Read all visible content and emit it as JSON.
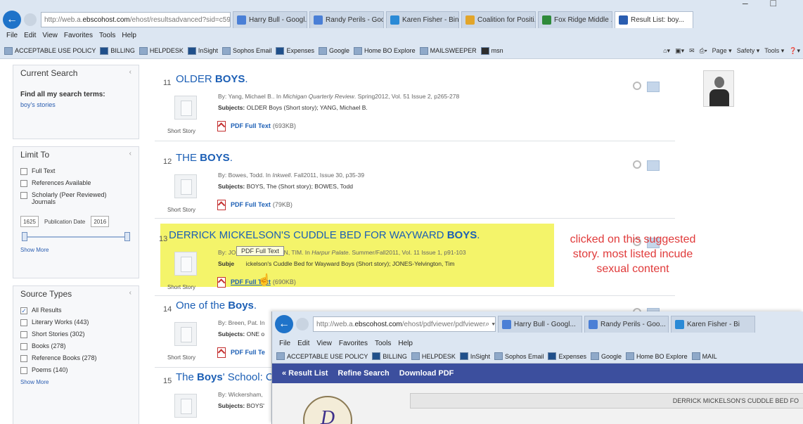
{
  "browser": {
    "address": {
      "prefix": "http://web.a.",
      "host": "ebscohost.com",
      "path": "/ehost/resultsadvanced?sid=c59d...",
      "controls": "⌕ ▾ ↻"
    },
    "tabs": [
      {
        "label": "Harry Bull - Googl...",
        "icon_color": "#4a7fd6"
      },
      {
        "label": "Randy Perils - Goo...",
        "icon_color": "#4a7fd6"
      },
      {
        "label": "Karen Fisher - Bing",
        "icon_color": "#2a8ad6"
      },
      {
        "label": "Coalition for Positi...",
        "icon_color": "#e2a52a"
      },
      {
        "label": "Fox Ridge Middle ...",
        "icon_color": "#2f8a3a"
      },
      {
        "label": "Result List: boy...",
        "icon_color": "#2a5db0"
      }
    ],
    "window_controls": "– □",
    "menu": [
      "File",
      "Edit",
      "View",
      "Favorites",
      "Tools",
      "Help"
    ],
    "favorites": [
      "ACCEPTABLE USE POLICY",
      "BILLING",
      "HELPDESK",
      "InSight",
      "Sophos Email",
      "Expenses",
      "Google",
      "Home BO Explore",
      "MAILSWEEPER",
      "msn"
    ],
    "commands": [
      "Page ▾",
      "Safety ▾",
      "Tools ▾"
    ]
  },
  "sidebar": {
    "current_search": {
      "heading": "Current Search",
      "find_all_label": "Find all my search terms:",
      "term": "boy's stories"
    },
    "limit_to": {
      "heading": "Limit To",
      "options": [
        {
          "label": "Full Text",
          "checked": false
        },
        {
          "label": "References Available",
          "checked": false
        },
        {
          "label": "Scholarly (Peer Reviewed) Journals",
          "checked": false
        }
      ],
      "date_from": "1625",
      "date_label": "Publication Date",
      "date_to": "2016",
      "show_more": "Show More"
    },
    "source_types": {
      "heading": "Source Types",
      "options": [
        {
          "label": "All Results",
          "checked": true
        },
        {
          "label": "Literary Works (443)",
          "checked": false
        },
        {
          "label": "Short Stories (302)",
          "checked": false
        },
        {
          "label": "Books (278)",
          "checked": false
        },
        {
          "label": "Reference Books (278)",
          "checked": false
        },
        {
          "label": "Poems (140)",
          "checked": false
        }
      ],
      "show_more": "Show More"
    }
  },
  "results": [
    {
      "num": "11",
      "title_plain": "OLDER ",
      "title_bold": "BOYS",
      "title_tail": ".",
      "meta_by": "By: Yang, Michael B.. ",
      "meta_in": "In ",
      "meta_source": "Michigan Quarterly Review",
      "meta_rest": ". Spring2012, Vol. 51 Issue 2, p265-278",
      "subjects_label": "Subjects:",
      "subjects": " OLDER Boys (Short story); YANG, Michael B.",
      "type": "Short Story",
      "pdf_label": "PDF Full Text",
      "pdf_size": "(693KB)"
    },
    {
      "num": "12",
      "title_plain": "THE ",
      "title_bold": "BOYS",
      "title_tail": ".",
      "meta_by": "By: Bowes, Todd. ",
      "meta_in": "In ",
      "meta_source": "Inkwell",
      "meta_rest": ". Fall2011, Issue 30, p35-39",
      "subjects_label": "Subjects:",
      "subjects": " BOYS, The (Short story); BOWES, Todd",
      "type": "Short Story",
      "pdf_label": "PDF Full Text",
      "pdf_size": "(79KB)"
    },
    {
      "num": "13",
      "title_plain": "DERRICK MICKELSON'S CUDDLE BED FOR WAYWARD ",
      "title_bold": "BOYS",
      "title_tail": ".",
      "meta_by": "By: JONES-YELVINGTON, TIM. ",
      "meta_in": "In ",
      "meta_source": "Harpur Palate",
      "meta_rest": ". Summer/Fall2011, Vol. 11 Issue 1, p91-103",
      "subjects_label": "Subje",
      "subjects": "       ickelson's Cuddle Bed for Wayward Boys (Short story); JONES-Yelvington, Tim",
      "type": "Short Story",
      "pdf_label": "PDF Full Text",
      "pdf_size": "(690KB)",
      "tooltip": "PDF Full Text"
    },
    {
      "num": "14",
      "title_plain": "One of the ",
      "title_bold": "Boys",
      "title_tail": ".",
      "meta_by": "By: Breen, Pat. ",
      "meta_in": "In",
      "meta_source": "",
      "meta_rest": "",
      "subjects_label": "Subjects:",
      "subjects": " ONE o",
      "type": "Short Story",
      "pdf_label": "PDF Full Te",
      "pdf_size": ""
    },
    {
      "num": "15",
      "title_plain": "The ",
      "title_bold": "Boys",
      "title_tail": "' School: C",
      "meta_by": "By: Wickersham, ",
      "meta_in": "",
      "meta_source": "",
      "meta_rest": "",
      "subjects_label": "Subjects:",
      "subjects": " BOYS'",
      "type": "",
      "pdf_label": "",
      "pdf_size": ""
    }
  ],
  "annotation": "clicked on this suggested story. most listed incude sexual content",
  "overlay": {
    "address": {
      "prefix": "http://web.a.",
      "host": "ebscohost.com",
      "path": "/ehost/pdfviewer/pdfviewer",
      "controls": "⌕ ▾ ↻"
    },
    "tabs": [
      {
        "label": "Harry Bull - Googl...",
        "icon_color": "#4a7fd6"
      },
      {
        "label": "Randy Perils - Goo...",
        "icon_color": "#4a7fd6"
      },
      {
        "label": "Karen Fisher - Bi",
        "icon_color": "#2a8ad6"
      }
    ],
    "menu": [
      "File",
      "Edit",
      "View",
      "Favorites",
      "Tools",
      "Help"
    ],
    "favorites": [
      "ACCEPTABLE USE POLICY",
      "BILLING",
      "HELPDESK",
      "InSight",
      "Sophos Email",
      "Expenses",
      "Google",
      "Home BO Explore",
      "MAIL"
    ],
    "toolbar": [
      "« Result List",
      "Refine Search",
      "Download PDF"
    ],
    "logo_letter": "D",
    "doc_title": "DERRICK MICKELSON'S CUDDLE BED FO"
  }
}
